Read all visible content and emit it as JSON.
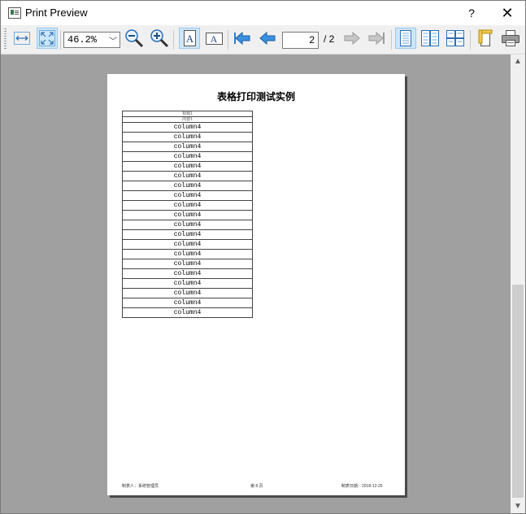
{
  "window": {
    "title": "Print Preview",
    "help_label": "?",
    "close_label": "✕"
  },
  "toolbar": {
    "zoom_value": "46.2%",
    "current_page": "2",
    "total_pages": "/ 2",
    "buttons": [
      {
        "name": "fit-width-button",
        "icon": "fit-width-icon",
        "checked": false
      },
      {
        "name": "fit-page-button",
        "icon": "fit-page-icon",
        "checked": true
      },
      {
        "name": "zoom-out-button",
        "icon": "zoom-out-icon",
        "checked": false
      },
      {
        "name": "zoom-in-button",
        "icon": "zoom-in-icon",
        "checked": false
      },
      {
        "name": "portrait-button",
        "icon": "portrait-icon",
        "checked": true
      },
      {
        "name": "landscape-button",
        "icon": "landscape-icon",
        "checked": false
      },
      {
        "name": "first-page-button",
        "icon": "first-page-icon",
        "checked": false
      },
      {
        "name": "previous-page-button",
        "icon": "previous-page-icon",
        "checked": false
      },
      {
        "name": "next-page-button",
        "icon": "next-page-icon",
        "checked": false
      },
      {
        "name": "last-page-button",
        "icon": "last-page-icon",
        "checked": false
      },
      {
        "name": "single-page-button",
        "icon": "single-page-icon",
        "checked": true
      },
      {
        "name": "facing-pages-button",
        "icon": "facing-pages-icon",
        "checked": false
      },
      {
        "name": "overview-button",
        "icon": "overview-icon",
        "checked": false
      },
      {
        "name": "page-setup-button",
        "icon": "page-setup-icon",
        "checked": false
      },
      {
        "name": "print-button",
        "icon": "printer-icon",
        "checked": false
      }
    ]
  },
  "page": {
    "title": "表格打印测试实例",
    "table": {
      "header_rows": [
        "标题1",
        "内容1"
      ],
      "rows": [
        "column4",
        "column4",
        "column4",
        "column4",
        "column4",
        "column4",
        "column4",
        "column4",
        "column4",
        "column4",
        "column4",
        "column4",
        "column4",
        "column4",
        "column4",
        "column4",
        "column4",
        "column4",
        "column4",
        "column4"
      ]
    },
    "footer": {
      "left": "制表人：系统管理员",
      "center": "第 8 页",
      "right": "制表日期：2018-12-25"
    }
  }
}
